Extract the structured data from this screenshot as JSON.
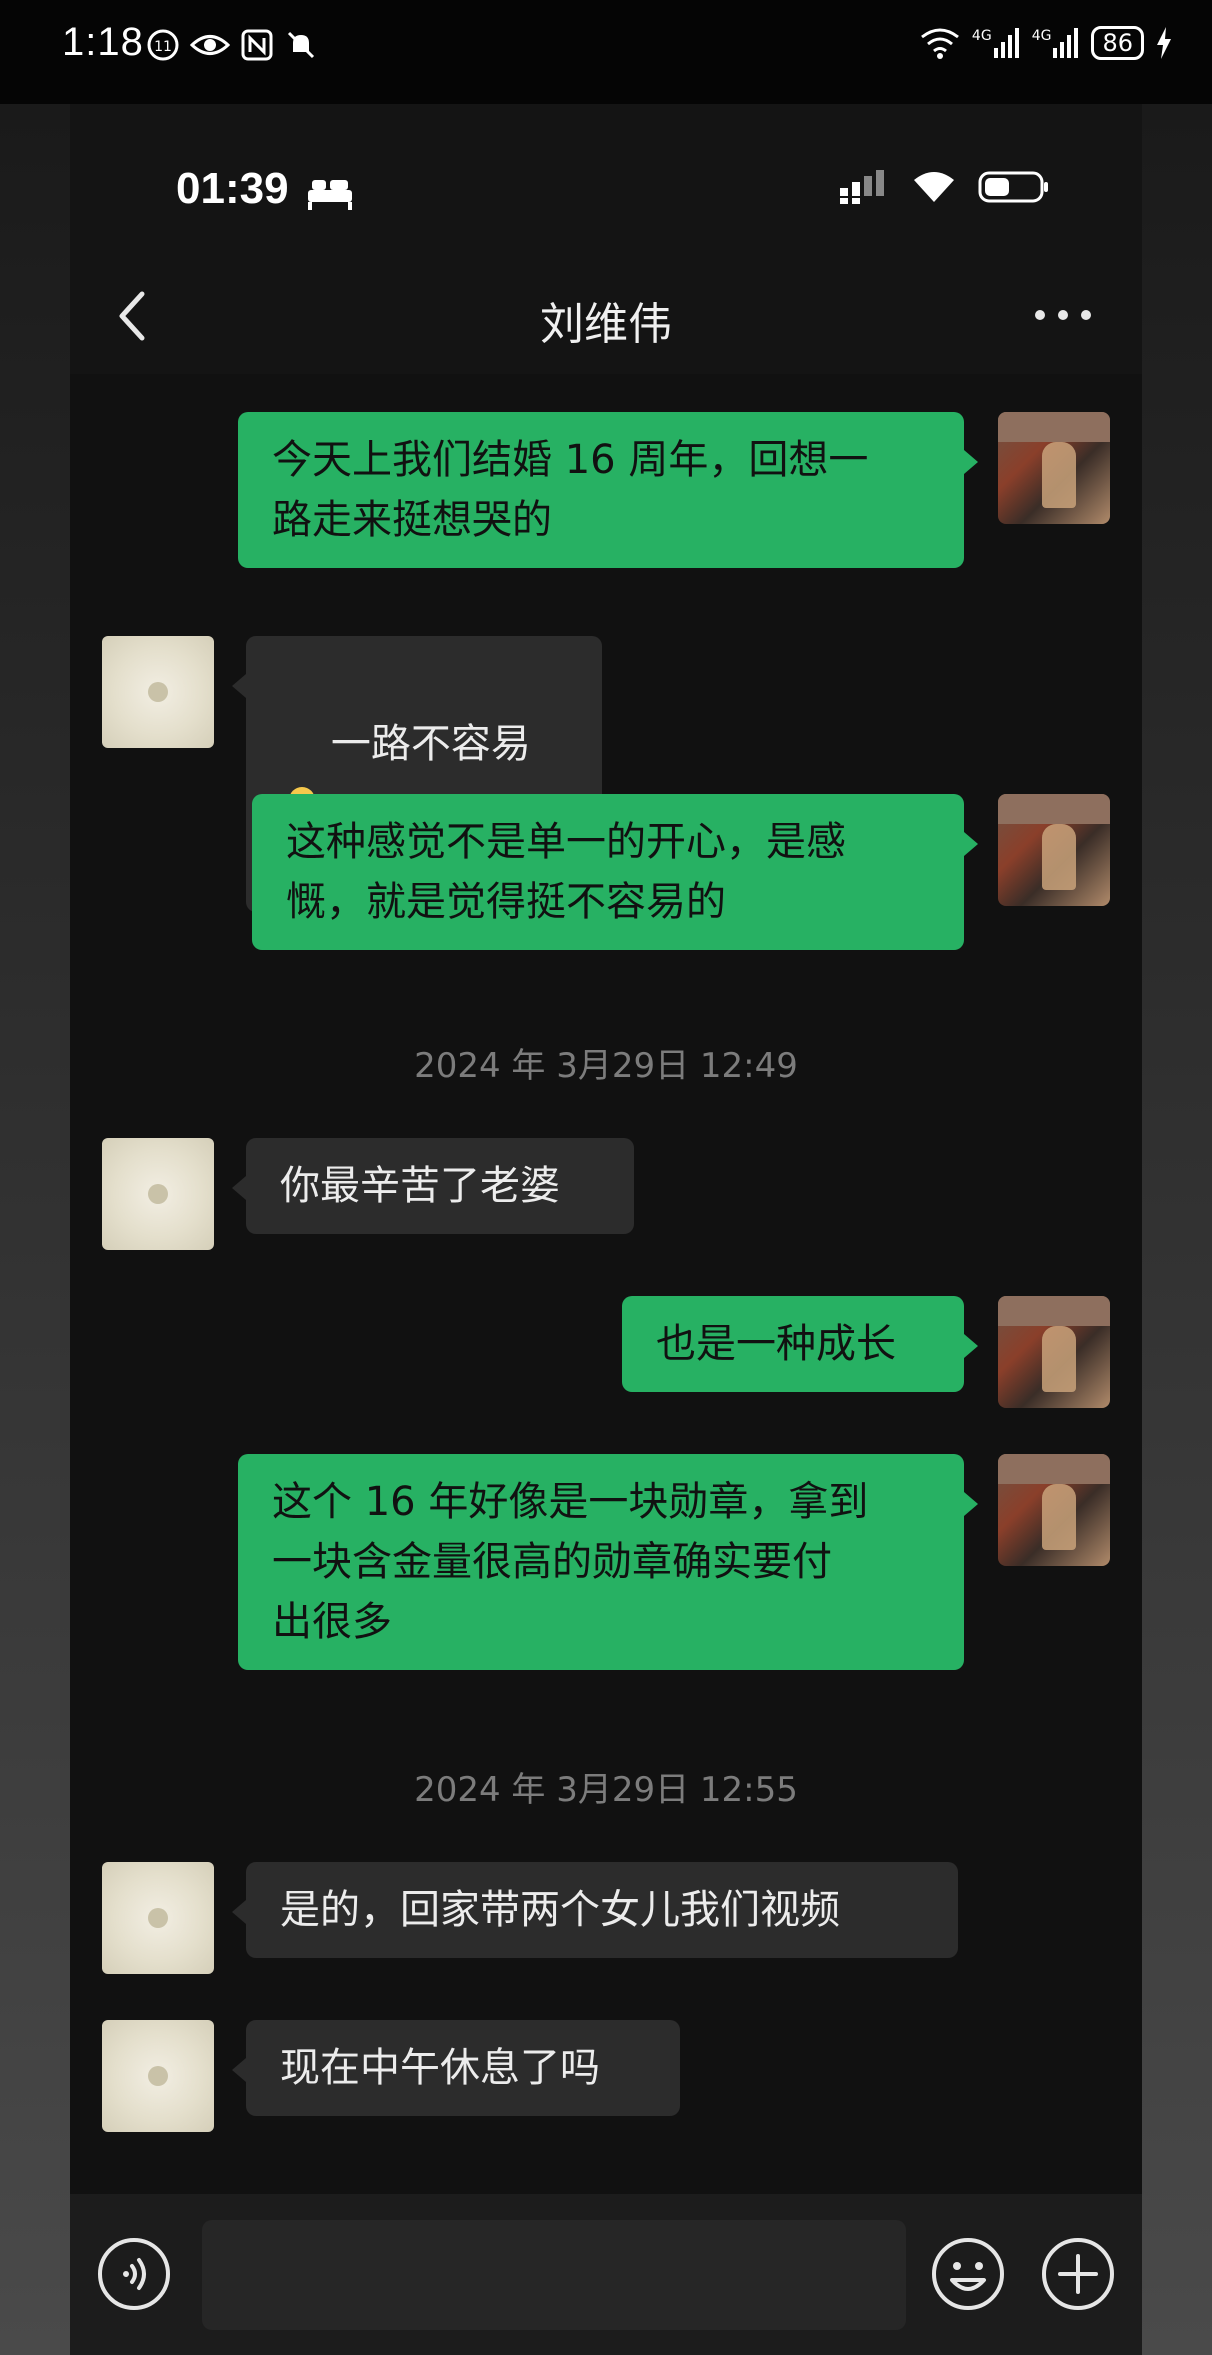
{
  "device": {
    "outer_time": "1:18",
    "outer_battery": "86",
    "outer_network_1": "4G",
    "outer_network_2": "4G",
    "inner_time": "01:39"
  },
  "header": {
    "title": "刘维伟"
  },
  "messages": [
    {
      "from": "me",
      "text": "今天上我们结婚 16 周年，回想一\n路走来挺想哭的"
    },
    {
      "from": "other",
      "text": "一路不容易"
    },
    {
      "from": "me",
      "text": "这种感觉不是单一的开心，是感\n慨，就是觉得挺不容易的"
    },
    {
      "from": "me",
      "text": "也是一种成长"
    },
    {
      "from": "me",
      "text": "这个 16 年好像是一块勋章，拿到\n一块含金量很高的勋章确实要付\n出很多"
    },
    {
      "from": "other",
      "text": "你最辛苦了老婆"
    },
    {
      "from": "other",
      "text": "是的，回家带两个女儿我们视频"
    },
    {
      "from": "other",
      "text": "现在中午休息了吗"
    }
  ],
  "timestamps": [
    "2024 年 3月29日 12:49",
    "2024 年 3月29日 12:55"
  ],
  "composer": {
    "placeholder": ""
  }
}
